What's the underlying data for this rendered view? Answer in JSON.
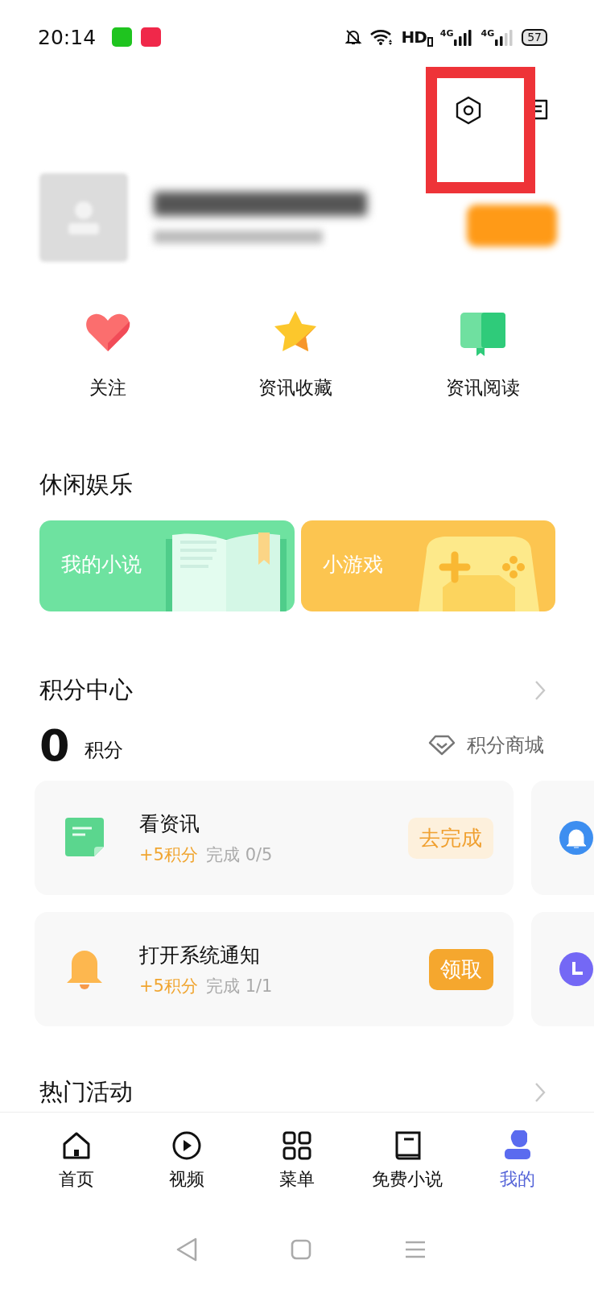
{
  "status_bar": {
    "time": "20:14",
    "hd": "HD",
    "network": [
      "4G",
      "4G"
    ],
    "battery": "57"
  },
  "quick_actions": [
    {
      "kind": "heart",
      "label": "关注"
    },
    {
      "kind": "star",
      "label": "资讯收藏"
    },
    {
      "kind": "book",
      "label": "资讯阅读"
    }
  ],
  "leisure": {
    "title": "休闲娱乐",
    "cards": [
      {
        "kind": "novel",
        "label": "我的小说"
      },
      {
        "kind": "game",
        "label": "小游戏"
      }
    ]
  },
  "points": {
    "title": "积分中心",
    "value": "0",
    "unit": "积分",
    "mall": "积分商城",
    "tasks": [
      {
        "kind": "note",
        "title": "看资讯",
        "reward": "+5积分",
        "progress": "完成 0/5",
        "action": "去完成",
        "claimable": false,
        "peek": {
          "kind": "bell",
          "color": "#3d8ef0"
        }
      },
      {
        "kind": "bell",
        "title": "打开系统通知",
        "reward": "+5积分",
        "progress": "完成 1/1",
        "action": "领取",
        "claimable": true,
        "peek": {
          "kind": "clock",
          "color": "#7468f5"
        }
      }
    ]
  },
  "activities": {
    "title": "热门活动"
  },
  "bottom_nav": [
    {
      "kind": "home",
      "label": "首页",
      "selected": false
    },
    {
      "kind": "play",
      "label": "视频",
      "selected": false
    },
    {
      "kind": "grid",
      "label": "菜单",
      "selected": false
    },
    {
      "kind": "novel",
      "label": "免费小说",
      "selected": false
    },
    {
      "kind": "person",
      "label": "我的",
      "selected": true
    }
  ]
}
